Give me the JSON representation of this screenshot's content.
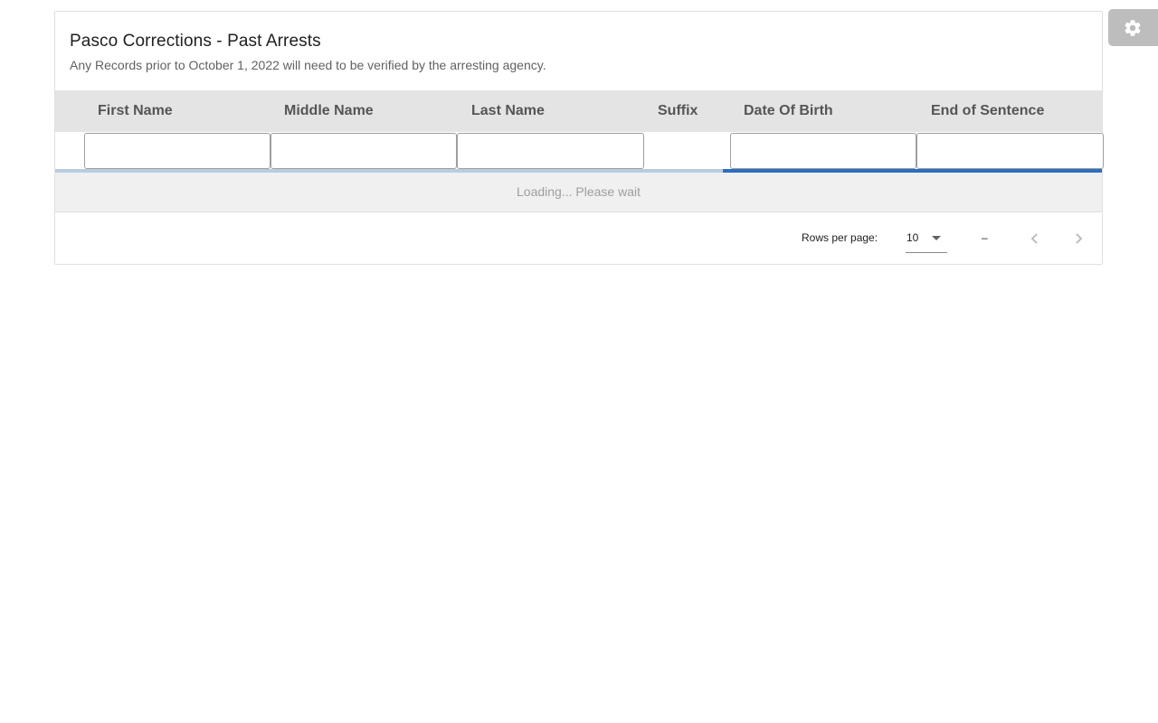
{
  "card": {
    "title": "Pasco Corrections - Past Arrests",
    "subtitle": "Any Records prior to October 1, 2022 will need to be verified by the arresting agency."
  },
  "table": {
    "columns": [
      "First Name",
      "Middle Name",
      "Last Name",
      "Suffix",
      "Date Of Birth",
      "End of Sentence"
    ],
    "filters": {
      "first_name": "",
      "middle_name": "",
      "last_name": "",
      "date_of_birth": "",
      "end_of_sentence": ""
    },
    "loading_text": "Loading... Please wait",
    "loading_progress_icon": "indeterminate-progress-bar"
  },
  "pagination": {
    "rows_per_page_label": "Rows per page:",
    "rows_per_page_value": "10",
    "range_text": "–",
    "prev_icon": "chevron-left-icon",
    "next_icon": "chevron-right-icon"
  },
  "settings": {
    "icon": "gear-icon"
  },
  "colors": {
    "header_bg": "#e4e4e4",
    "progress_track": "#b8cde2",
    "progress_bar": "#2c6ec0",
    "loading_bg": "#f0f0f0",
    "settings_bg": "#bdbdbd"
  }
}
